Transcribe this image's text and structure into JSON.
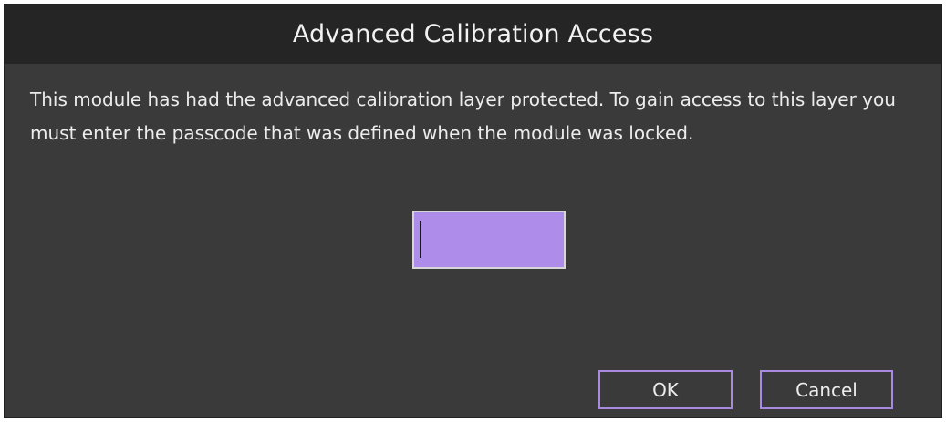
{
  "dialog": {
    "title": "Advanced Calibration Access",
    "message": "This module has had the advanced calibration layer protected. To gain access to this layer you must enter the passcode that was defined when the module was locked.",
    "passcode": {
      "value": "",
      "placeholder": ""
    },
    "buttons": {
      "ok_label": "OK",
      "cancel_label": "Cancel"
    }
  },
  "colors": {
    "background": "#3a3a3a",
    "titlebar": "#252525",
    "input_fill": "#ad8de9",
    "button_border": "#a98ae0",
    "text": "#ececec"
  }
}
